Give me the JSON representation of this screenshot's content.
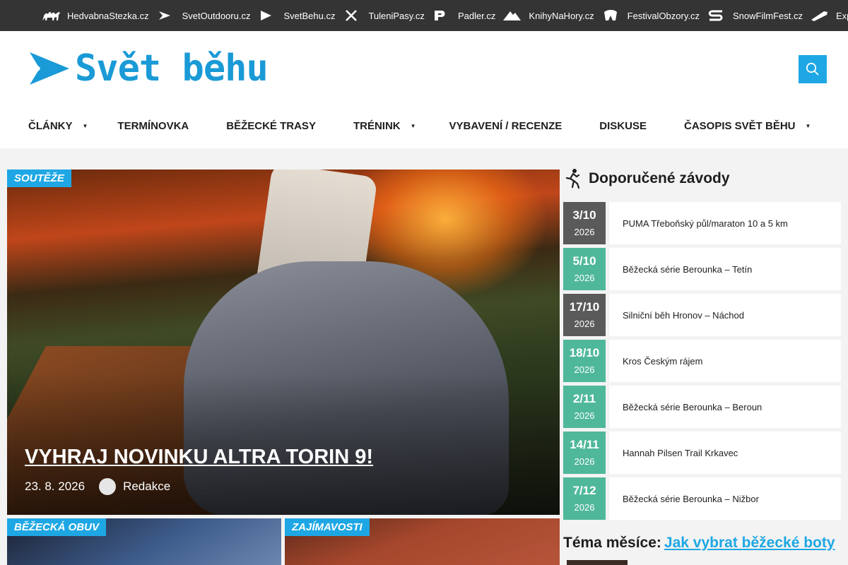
{
  "network": [
    {
      "label": "HedvabnaStezka.cz",
      "icon": "camel-icon"
    },
    {
      "label": "SvetOutdooru.cz",
      "icon": "arrow-chevron-icon"
    },
    {
      "label": "SvetBehu.cz",
      "icon": "play-flag-icon"
    },
    {
      "label": "TuleniPasy.cz",
      "icon": "crossed-skis-icon"
    },
    {
      "label": "Padler.cz",
      "icon": "p-letter-icon"
    },
    {
      "label": "KnihyNaHory.cz",
      "icon": "mountain-icon"
    },
    {
      "label": "FestivalObzory.cz",
      "icon": "festival-badge-icon"
    },
    {
      "label": "SnowFilmFest.cz",
      "icon": "s-letter-icon"
    },
    {
      "label": "ExpedicniKamera.cz",
      "icon": "expedition-pen-icon"
    }
  ],
  "site": {
    "logo_text": "Svět běhu",
    "accent": "#1ea7e4"
  },
  "nav": [
    {
      "label": "ČLÁNKY",
      "dropdown": true
    },
    {
      "label": "TERMÍNOVKA",
      "dropdown": false
    },
    {
      "label": "BĚŽECKÉ TRASY",
      "dropdown": false
    },
    {
      "label": "TRÉNINK",
      "dropdown": true
    },
    {
      "label": "VYBAVENÍ / RECENZE",
      "dropdown": false
    },
    {
      "label": "DISKUSE",
      "dropdown": false
    },
    {
      "label": "ČASOPIS SVĚT BĚHU",
      "dropdown": true
    }
  ],
  "hero": {
    "category": "SOUTĚŽE",
    "title": "VYHRAJ NOVINKU ALTRA TORIN 9!",
    "date": "23. 8. 2026",
    "author": "Redakce"
  },
  "cards": [
    {
      "category": "BĚŽECKÁ OBUV"
    },
    {
      "category": "ZAJÍMAVOSTI"
    }
  ],
  "sidebar": {
    "title": "Doporučené závody",
    "races": [
      {
        "day": "3/10",
        "year": "2026",
        "name": "PUMA Třeboňský půl/maraton 10 a 5 km",
        "color": "#5a5a5a"
      },
      {
        "day": "5/10",
        "year": "2026",
        "name": "Běžecká série Berounka – Tetín",
        "color": "#4fb89a"
      },
      {
        "day": "17/10",
        "year": "2026",
        "name": "Silniční běh Hronov – Náchod",
        "color": "#5a5a5a"
      },
      {
        "day": "18/10",
        "year": "2026",
        "name": "Kros Českým rájem",
        "color": "#4fb89a"
      },
      {
        "day": "2/11",
        "year": "2026",
        "name": "Běžecká série Berounka – Beroun",
        "color": "#4fb89a"
      },
      {
        "day": "14/11",
        "year": "2026",
        "name": "Hannah Pilsen Trail Krkavec",
        "color": "#4fb89a"
      },
      {
        "day": "7/12",
        "year": "2026",
        "name": "Běžecká série Berounka – Nižbor",
        "color": "#4fb89a"
      }
    ],
    "theme_label": "Téma měsíce:",
    "theme_link": "Jak vybrat běžecké boty"
  }
}
